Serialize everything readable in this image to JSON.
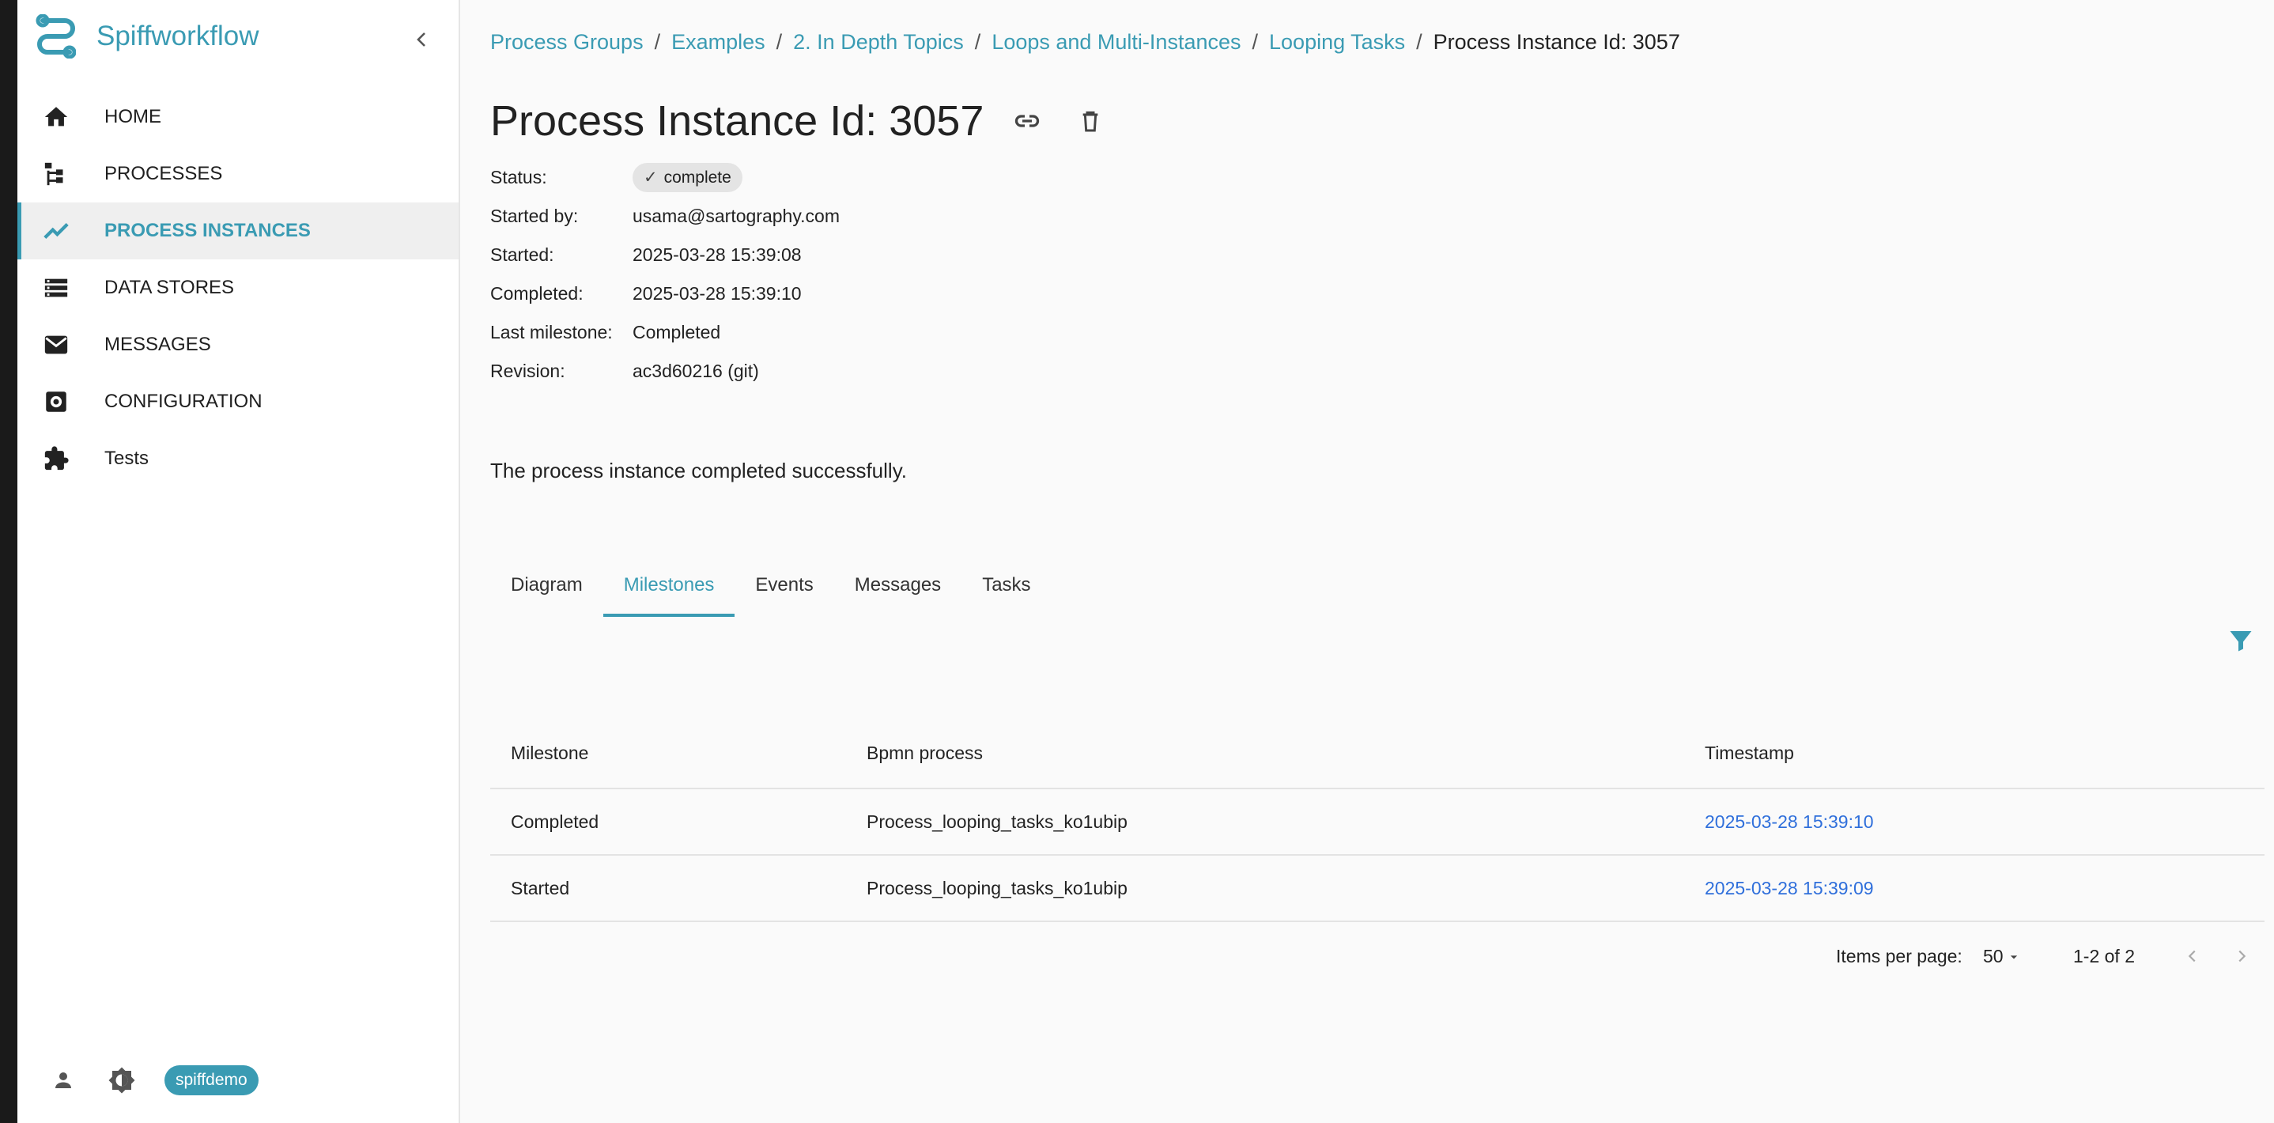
{
  "app": {
    "name": "Spiffworkflow"
  },
  "sidebar": {
    "items": [
      {
        "label": "HOME",
        "icon": "home-icon"
      },
      {
        "label": "PROCESSES",
        "icon": "tree-icon"
      },
      {
        "label": "PROCESS INSTANCES",
        "icon": "trend-icon"
      },
      {
        "label": "DATA STORES",
        "icon": "storage-icon"
      },
      {
        "label": "MESSAGES",
        "icon": "mail-icon"
      },
      {
        "label": "CONFIGURATION",
        "icon": "settings-icon"
      },
      {
        "label": "Tests",
        "icon": "puzzle-icon"
      }
    ],
    "active_index": 2,
    "user_chip": "spiffdemo"
  },
  "breadcrumb": {
    "items": [
      "Process Groups",
      "Examples",
      "2. In Depth Topics",
      "Loops and Multi-Instances",
      "Looping Tasks"
    ],
    "current": "Process Instance Id: 3057",
    "separator": "/"
  },
  "page": {
    "title": "Process Instance Id: 3057",
    "meta": {
      "status_label": "Status:",
      "status_value": "complete",
      "started_by_label": "Started by:",
      "started_by_value": "usama@sartography.com",
      "started_label": "Started:",
      "started_value": "2025-03-28 15:39:08",
      "completed_label": "Completed:",
      "completed_value": "2025-03-28 15:39:10",
      "milestone_label": "Last milestone:",
      "milestone_value": "Completed",
      "revision_label": "Revision:",
      "revision_value": "ac3d60216 (git)"
    },
    "message": "The process instance completed successfully."
  },
  "tabs": {
    "items": [
      "Diagram",
      "Milestones",
      "Events",
      "Messages",
      "Tasks"
    ],
    "active_index": 1
  },
  "table": {
    "headers": [
      "Milestone",
      "Bpmn process",
      "Timestamp"
    ],
    "rows": [
      [
        "Completed",
        "Process_looping_tasks_ko1ubip",
        "2025-03-28 15:39:10"
      ],
      [
        "Started",
        "Process_looping_tasks_ko1ubip",
        "2025-03-28 15:39:09"
      ]
    ]
  },
  "pager": {
    "items_per_page_label": "Items per page:",
    "items_per_page": "50",
    "range": "1-2 of 2"
  },
  "colors": {
    "accent": "#3a9bb3",
    "link": "#2f6fdb"
  }
}
